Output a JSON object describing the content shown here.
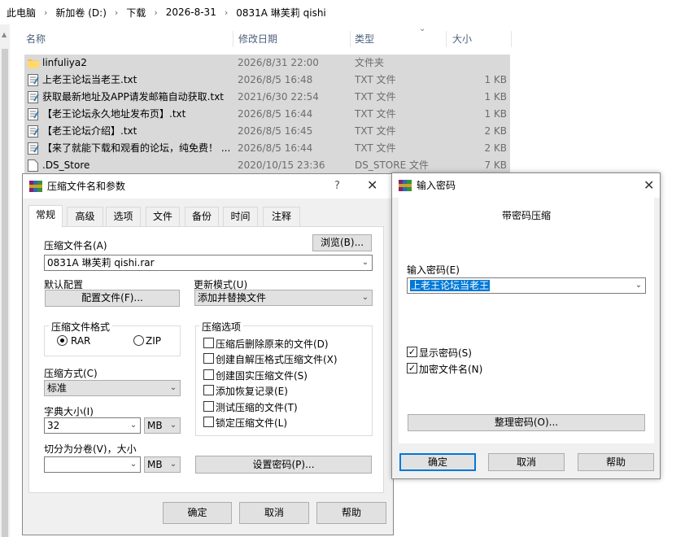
{
  "breadcrumb": [
    "此电脑",
    "新加卷 (D:)",
    "下载",
    "2026-8-31",
    "0831A 琳芙莉 qishi"
  ],
  "explorer": {
    "columns": [
      "名称",
      "修改日期",
      "类型",
      "大小"
    ],
    "files": [
      {
        "name": "linfuliya2",
        "date": "2026/8/31 22:00",
        "type": "文件夹",
        "size": "",
        "icon": "folder-icon"
      },
      {
        "name": "上老王论坛当老王.txt",
        "date": "2026/8/5 16:48",
        "type": "TXT 文件",
        "size": "1 KB",
        "icon": "text-file-icon"
      },
      {
        "name": "获取最新地址及APP请发邮箱自动获取.txt",
        "date": "2021/6/30 22:54",
        "type": "TXT 文件",
        "size": "1 KB",
        "icon": "text-file-icon"
      },
      {
        "name": "【老王论坛永久地址发布页】.txt",
        "date": "2026/8/5 16:44",
        "type": "TXT 文件",
        "size": "1 KB",
        "icon": "text-file-icon"
      },
      {
        "name": "【老王论坛介绍】.txt",
        "date": "2026/8/5 16:45",
        "type": "TXT 文件",
        "size": "2 KB",
        "icon": "text-file-icon"
      },
      {
        "name": "【来了就能下载和观看的论坛，纯免费！ ...",
        "date": "2026/8/5 16:44",
        "type": "TXT 文件",
        "size": "2 KB",
        "icon": "text-file-icon"
      },
      {
        "name": ".DS_Store",
        "date": "2020/10/15 23:36",
        "type": "DS_STORE 文件",
        "size": "7 KB",
        "icon": "generic-file-icon"
      }
    ]
  },
  "archive_dialog": {
    "title": "压缩文件名和参数",
    "help_glyph": "?",
    "tabs": [
      "常规",
      "高级",
      "选项",
      "文件",
      "备份",
      "时间",
      "注释"
    ],
    "archive_name_label": "压缩文件名(A)",
    "browse_label": "浏览(B)...",
    "archive_name_value": "0831A 琳芙莉 qishi.rar",
    "default_profile_label": "默认配置",
    "profiles_button": "配置文件(F)...",
    "update_mode_label": "更新模式(U)",
    "update_mode_value": "添加并替换文件",
    "format_group": "压缩文件格式",
    "format_rar": "RAR",
    "format_zip": "ZIP",
    "options_group": "压缩选项",
    "options": [
      {
        "label": "压缩后删除原来的文件(D)",
        "checked": false
      },
      {
        "label": "创建自解压格式压缩文件(X)",
        "checked": false
      },
      {
        "label": "创建固实压缩文件(S)",
        "checked": false
      },
      {
        "label": "添加恢复记录(E)",
        "checked": false
      },
      {
        "label": "测试压缩的文件(T)",
        "checked": false
      },
      {
        "label": "锁定压缩文件(L)",
        "checked": false
      }
    ],
    "method_label": "压缩方式(C)",
    "method_value": "标准",
    "dict_label": "字典大小(I)",
    "dict_value": "32",
    "dict_unit": "MB",
    "split_label": "切分为分卷(V)，大小",
    "split_value": "",
    "split_unit": "MB",
    "set_password_button": "设置密码(P)...",
    "ok": "确定",
    "cancel": "取消",
    "help": "帮助"
  },
  "password_dialog": {
    "title": "输入密码",
    "heading": "带密码压缩",
    "enter_label": "输入密码(E)",
    "password_value": "上老王论坛当老王",
    "show_password_label": "显示密码(S)",
    "encrypt_names_label": "加密文件名(N)",
    "organize_button": "整理密码(O)...",
    "ok": "确定",
    "cancel": "取消",
    "help": "帮助"
  },
  "colors": {
    "accent": "#0078d7",
    "selection_row": "#d9d9d9",
    "dialog_bg": "#f0f0f0"
  }
}
